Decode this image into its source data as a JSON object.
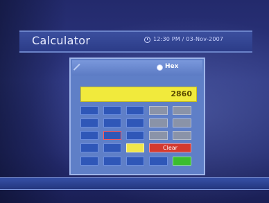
{
  "header": {
    "title": "Calculator",
    "datetime": "12:30 PM / 03-Nov-2007"
  },
  "icons": {
    "clock": "clock-icon",
    "radio": "radio-selected-icon",
    "corner": "corner-deco-icon"
  },
  "calculator": {
    "mode_label": "Hex",
    "display_value": "2860",
    "clear_label": "Clear",
    "colors": {
      "display": "#f1ea3c",
      "clear": "#d43a2f",
      "equals": "#3bbd2e",
      "panel": "#5f7fc7"
    }
  }
}
